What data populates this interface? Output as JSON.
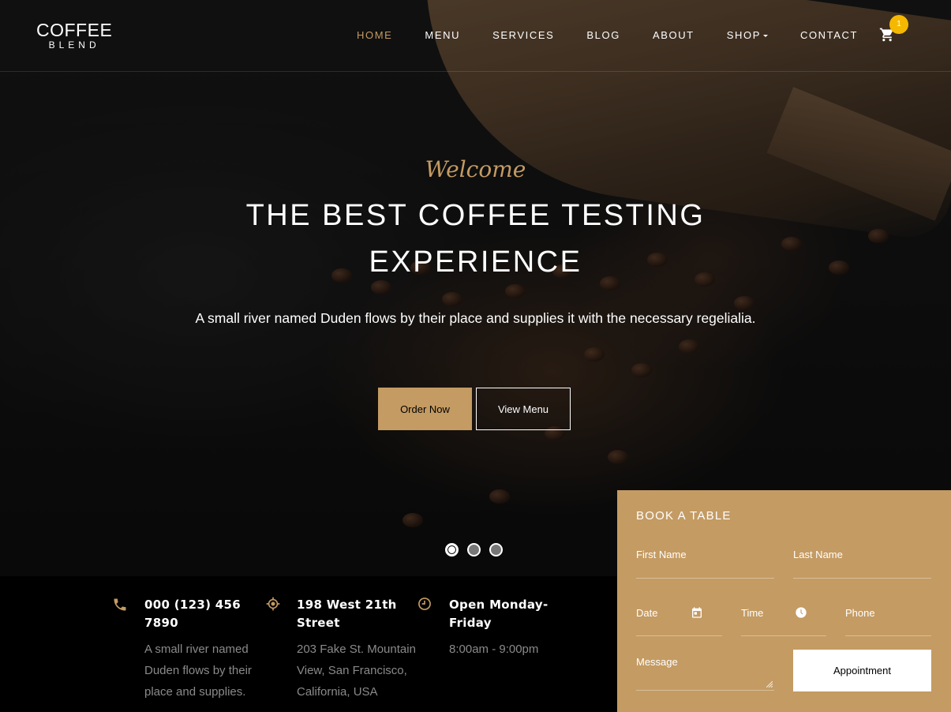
{
  "brand": {
    "logo_top": "COFFEE",
    "logo_bottom": "BLEND"
  },
  "nav": {
    "items": [
      {
        "label": "HOME",
        "active": true
      },
      {
        "label": "MENU"
      },
      {
        "label": "SERVICES"
      },
      {
        "label": "BLOG"
      },
      {
        "label": "ABOUT"
      },
      {
        "label": "SHOP",
        "dropdown": true
      },
      {
        "label": "CONTACT"
      }
    ],
    "cart_icon": "cart-icon",
    "cart_count": "1"
  },
  "hero": {
    "welcome": "Welcome",
    "title": "THE BEST COFFEE TESTING EXPERIENCE",
    "subtitle": "A small river named Duden flows by their place and supplies it with the necessary regelialia.",
    "order_button": "Order Now",
    "view_button": "View Menu",
    "slides": 3,
    "active_slide": 1
  },
  "info": {
    "phone": {
      "icon": "phone-icon",
      "title": "000 (123) 456 7890",
      "text": "A small river named Duden flows by their place and supplies."
    },
    "address": {
      "icon": "location-icon",
      "title": "198 West 21th Street",
      "text": "203 Fake St. Mountain View, San Francisco, California, USA"
    },
    "hours": {
      "icon": "clock-icon",
      "title": "Open Monday-Friday",
      "text": "8:00am - 9:00pm"
    }
  },
  "booking": {
    "title": "BOOK A TABLE",
    "first_name": "First Name",
    "last_name": "Last Name",
    "date": "Date",
    "time": "Time",
    "phone": "Phone",
    "message": "Message",
    "submit": "Appointment"
  },
  "colors": {
    "accent": "#c49b63",
    "badge": "#f5b800"
  }
}
